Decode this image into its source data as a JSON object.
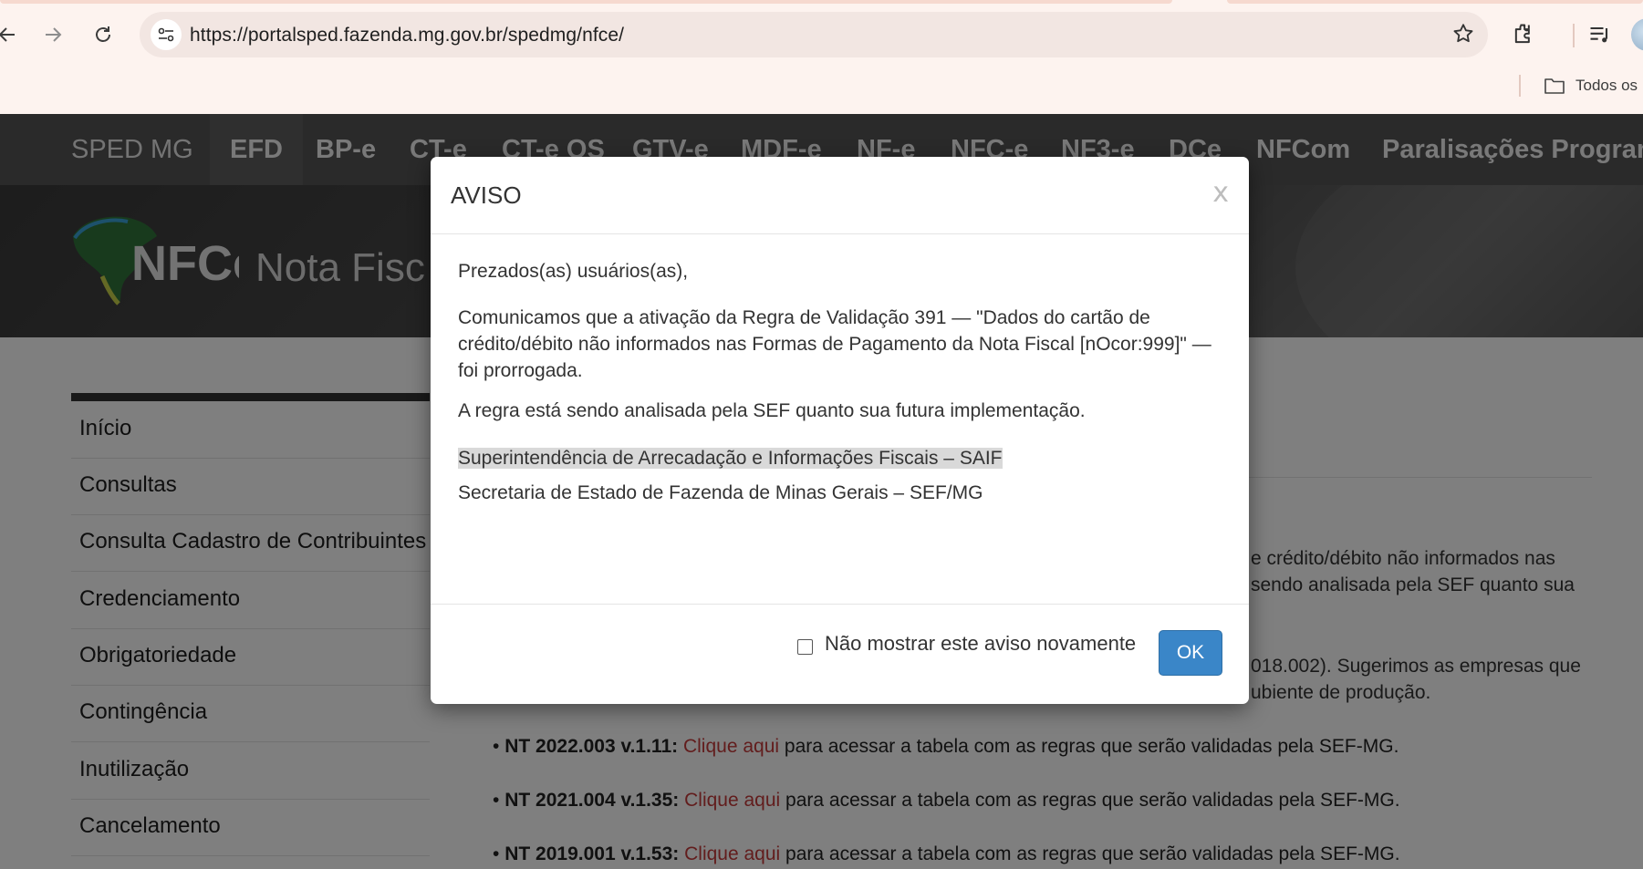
{
  "browser": {
    "url": "https://portalsped.fazenda.mg.gov.br/spedmg/nfce/",
    "bookmarks_folder": "Todos os"
  },
  "topnav": {
    "brand": "SPED MG",
    "items": [
      "EFD",
      "BP-e",
      "CT-e",
      "CT-e OS",
      "GTV-e",
      "MDF-e",
      "NF-e",
      "NFC-e",
      "NF3-e",
      "DCe",
      "NFCom",
      "Paralisações Programa"
    ]
  },
  "header": {
    "logo_text": "NFCe",
    "title": "Nota Fisc"
  },
  "sidebar": {
    "items": [
      "Início",
      "Consultas",
      "Consulta Cadastro de Contribuintes",
      "Credenciamento",
      "Obrigatoriedade",
      "Contingência",
      "Inutilização",
      "Cancelamento"
    ]
  },
  "main": {
    "frag1a": "e crédito/débito não informados nas",
    "frag1b": "sendo analisada pela SEF quanto sua",
    "frag2a": "018.002). Sugerimos as empresas que",
    "frag2b": "ubiente de produção.",
    "nt_items": [
      {
        "label": "NT 2022.003 v.1.11:",
        "link": "Clique aqui",
        "text": "para acessar a tabela com as regras que serão validadas pela SEF-MG."
      },
      {
        "label": "NT 2021.004 v.1.35:",
        "link": "Clique aqui",
        "text": "para acessar a tabela com as regras que serão validadas pela SEF-MG."
      },
      {
        "label": "NT 2019.001 v.1.53:",
        "link": "Clique aqui",
        "text": "para acessar a tabela com as regras que serão validadas pela SEF-MG."
      }
    ],
    "bullet": "•"
  },
  "modal": {
    "title": "AVISO",
    "close": "x",
    "greeting": "Prezados(as) usuários(as),",
    "paragraph1": "Comunicamos que a ativação da Regra de Validação 391 — \"Dados do cartão de crédito/débito não informados nas Formas de Pagamento da Nota Fiscal [nOcor:999]\" — foi prorrogada.",
    "paragraph2": "A regra está sendo analisada pela SEF quanto sua futura implementação.",
    "signature1": "Superintendência de Arrecadação e Informações Fiscais – SAIF",
    "signature2": "Secretaria de Estado de Fazenda de Minas Gerais – SEF/MG",
    "dont_show_label": "Não mostrar este aviso novamente",
    "ok_label": "OK"
  },
  "colors": {
    "ok_button": "#3a86c8",
    "link": "#c43a3a",
    "topnav": "#545454"
  }
}
